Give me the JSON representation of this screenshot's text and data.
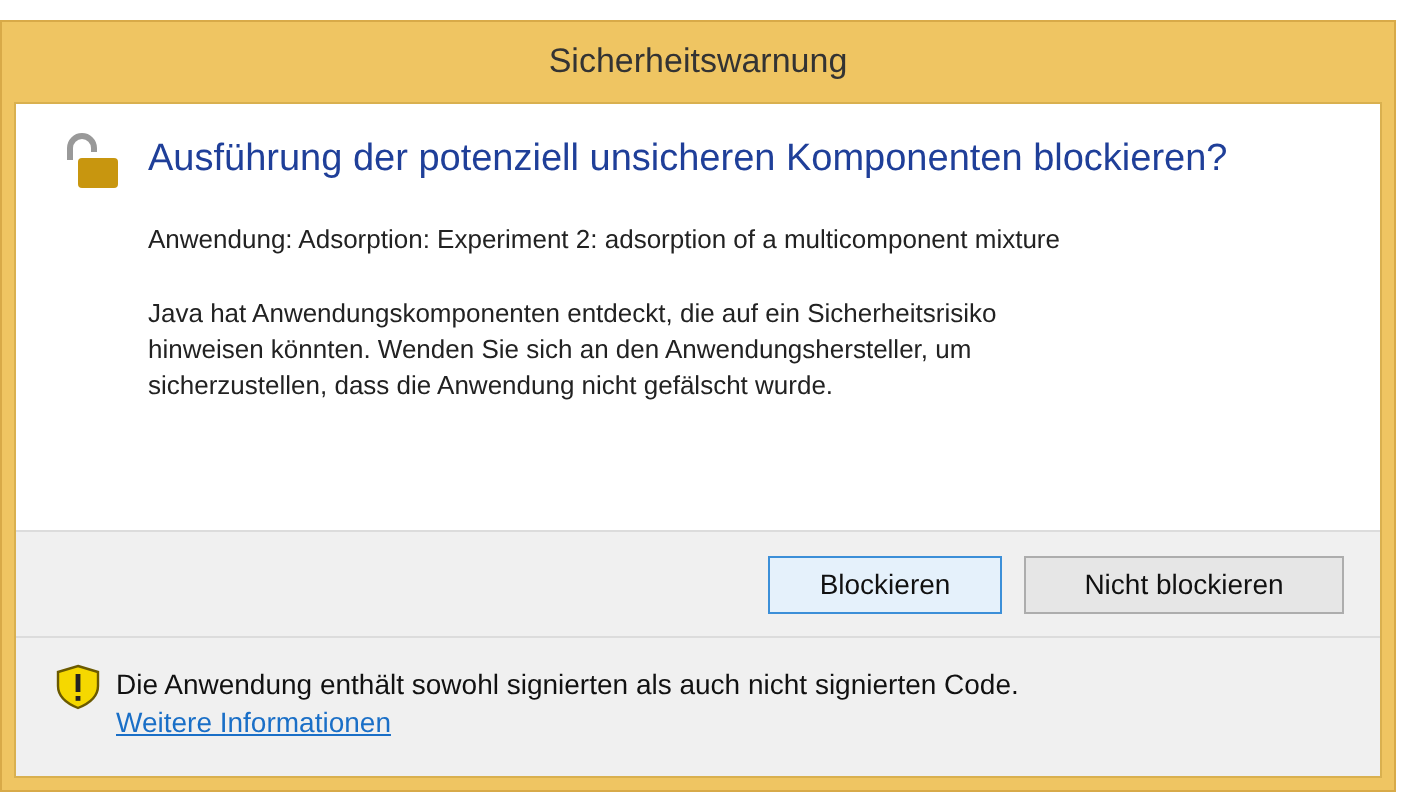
{
  "window": {
    "title": "Sicherheitswarnung"
  },
  "heading": "Ausführung der potenziell unsicheren Komponenten blockieren?",
  "application_line": "Anwendung: Adsorption: Experiment 2: adsorption of a multicomponent mixture",
  "message": "Java hat Anwendungskomponenten entdeckt, die auf ein Sicherheitsrisiko hinweisen könnten. Wenden Sie sich an den Anwendungshersteller, um sicherzustellen, dass die Anwendung nicht gefälscht wurde.",
  "buttons": [
    {
      "label": "Blockieren",
      "focused": true
    },
    {
      "label": "Nicht blockieren",
      "focused": false
    }
  ],
  "footer": {
    "text": "Die Anwendung enthält sowohl signierten als auch nicht signierten Code.",
    "link": "Weitere Informationen"
  }
}
